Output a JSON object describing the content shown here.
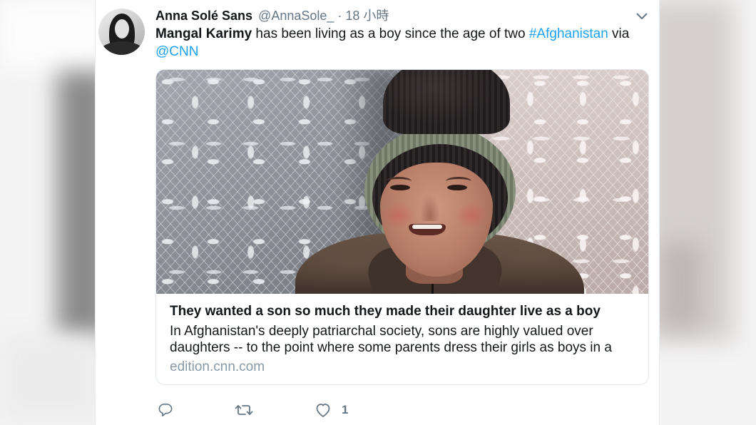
{
  "tweet": {
    "author": {
      "name": "Anna Solé Sans",
      "handle": "@AnnaSole_",
      "separator": "·",
      "time": "18 小時"
    },
    "text": {
      "highlight": "Mangal Karimy",
      "segment_1": " has been living as a boy since the age of two ",
      "hashtag": "#Afghanistan",
      "segment_2": " via",
      "mention": "@CNN"
    },
    "card": {
      "title": "They wanted a son so much they made their daughter live as a boy",
      "description_lines": [
        "In Afghanistan's deeply patriarchal society, sons are highly valued over",
        "daughters -- to the point where some parents dress their girls as boys in a"
      ],
      "domain": "edition.cnn.com"
    },
    "actions": {
      "like_count": "1"
    }
  },
  "icons": {
    "menu": "chevron-down-icon",
    "reply": "reply-icon",
    "retweet": "retweet-icon",
    "like": "heart-icon"
  },
  "colors": {
    "text_primary": "#14171a",
    "text_secondary": "#657786",
    "link": "#1da1f2",
    "card_border": "#e1e8ed",
    "domain": "#8899a6"
  }
}
